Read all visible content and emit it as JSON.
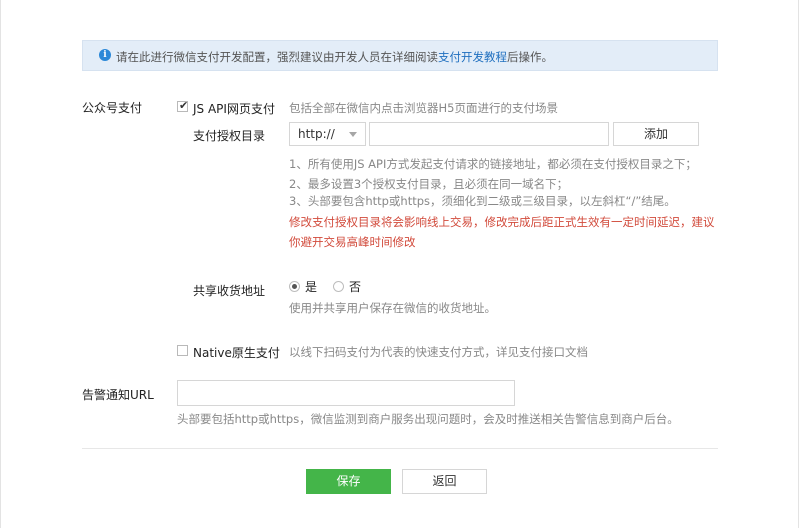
{
  "notice": {
    "text": "请在此进行微信支付开发配置，强烈建议由开发人员在详细阅读",
    "link": "支付开发教程",
    "suffix": "后操作。"
  },
  "public_pay": {
    "section_label": "公众号支付",
    "jsapi": {
      "checked": true,
      "label": "JS API网页支付",
      "desc": "包括全部在微信内点击浏览器H5页面进行的支付场景"
    },
    "auth_dir": {
      "label": "支付授权目录",
      "protocol_value": "http://",
      "url_value": "",
      "add_button": "添加"
    },
    "rules": [
      "1、所有使用JS API方式发起支付请求的链接地址，都必须在支付授权目录之下；",
      "2、最多设置3个授权支付目录，且必须在同一域名下；",
      "3、头部要包含http或https，须细化到二级或三级目录，以左斜杠“/”结尾。"
    ],
    "warning": "修改支付授权目录将会影响线上交易，修改完成后距正式生效有一定时间延迟，建议你避开交易高峰时间修改",
    "share_address": {
      "label": "共享收货地址",
      "option_yes": "是",
      "option_no": "否",
      "selected": "是",
      "desc": "使用并共享用户保存在微信的收货地址。"
    },
    "native": {
      "checked": false,
      "label": "Native原生支付",
      "desc": "以线下扫码支付为代表的快速支付方式，详见支付接口文档"
    }
  },
  "alert_url": {
    "label": "告警通知URL",
    "value": "",
    "hint": "头部要包括http或https，微信监测到商户服务出现问题时，会及时推送相关告警信息到商户后台。"
  },
  "actions": {
    "save": "保存",
    "back": "返回"
  },
  "colors": {
    "primary_green": "#44b549",
    "link_blue": "#1f6fbf",
    "warning_red": "#d24b3c",
    "notice_bg": "#e3edf8"
  }
}
